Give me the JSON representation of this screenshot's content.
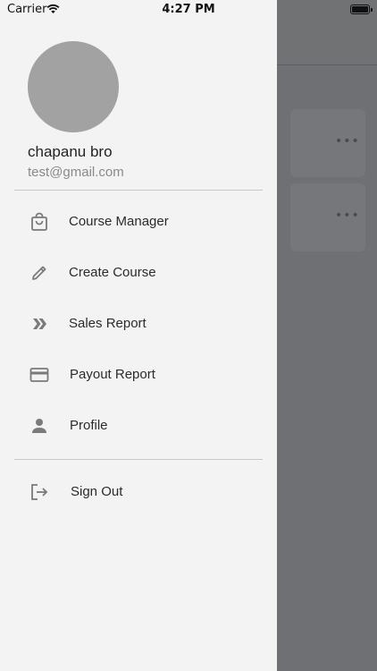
{
  "status_bar": {
    "carrier": "Carrier",
    "time": "4:27 PM"
  },
  "user": {
    "name": "chapanu bro",
    "email": "test@gmail.com"
  },
  "menu": {
    "items": [
      {
        "label": "Course Manager",
        "icon": "shopping-bag-icon"
      },
      {
        "label": "Create Course",
        "icon": "pencil-icon"
      },
      {
        "label": "Sales Report",
        "icon": "double-chevron-right-icon"
      },
      {
        "label": "Payout Report",
        "icon": "credit-card-icon"
      },
      {
        "label": "Profile",
        "icon": "person-icon"
      }
    ],
    "sign_out": {
      "label": "Sign Out",
      "icon": "logout-icon"
    }
  },
  "background": {
    "overflow_icon": "more-horizontal-icon"
  },
  "colors": {
    "drawer_bg": "#f3f3f3",
    "scrim": "#6f7073",
    "icon": "#7a7a7a",
    "avatar": "#a2a2a2"
  }
}
